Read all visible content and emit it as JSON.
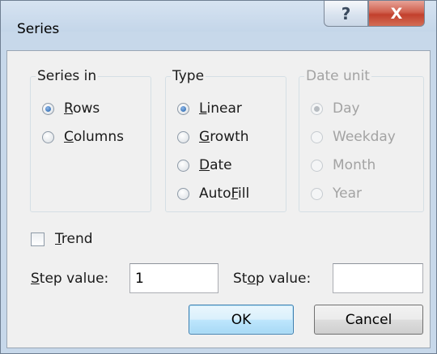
{
  "window": {
    "title": "Series",
    "help_label": "?",
    "close_label": "X"
  },
  "series_in": {
    "legend": "Series in",
    "options": [
      {
        "pre": "",
        "key": "R",
        "post": "ows",
        "selected": true
      },
      {
        "pre": "",
        "key": "C",
        "post": "olumns",
        "selected": false
      }
    ]
  },
  "type": {
    "legend": "Type",
    "options": [
      {
        "pre": "",
        "key": "L",
        "post": "inear",
        "selected": true
      },
      {
        "pre": "",
        "key": "G",
        "post": "rowth",
        "selected": false
      },
      {
        "pre": "",
        "key": "D",
        "post": "ate",
        "selected": false
      },
      {
        "pre": "Auto",
        "key": "F",
        "post": "ill",
        "selected": false
      }
    ]
  },
  "date_unit": {
    "legend": "Date unit",
    "enabled": false,
    "options": [
      {
        "label": "Day",
        "selected": true
      },
      {
        "label": "Weekday",
        "selected": false
      },
      {
        "label": "Month",
        "selected": false
      },
      {
        "label": "Year",
        "selected": false
      }
    ]
  },
  "trend": {
    "key": "T",
    "post": "rend",
    "checked": false
  },
  "step": {
    "key": "S",
    "post": "tep value:",
    "value": "1"
  },
  "stop": {
    "pre": "St",
    "key": "o",
    "post": "p value:",
    "value": ""
  },
  "buttons": {
    "ok": "OK",
    "cancel": "Cancel"
  }
}
